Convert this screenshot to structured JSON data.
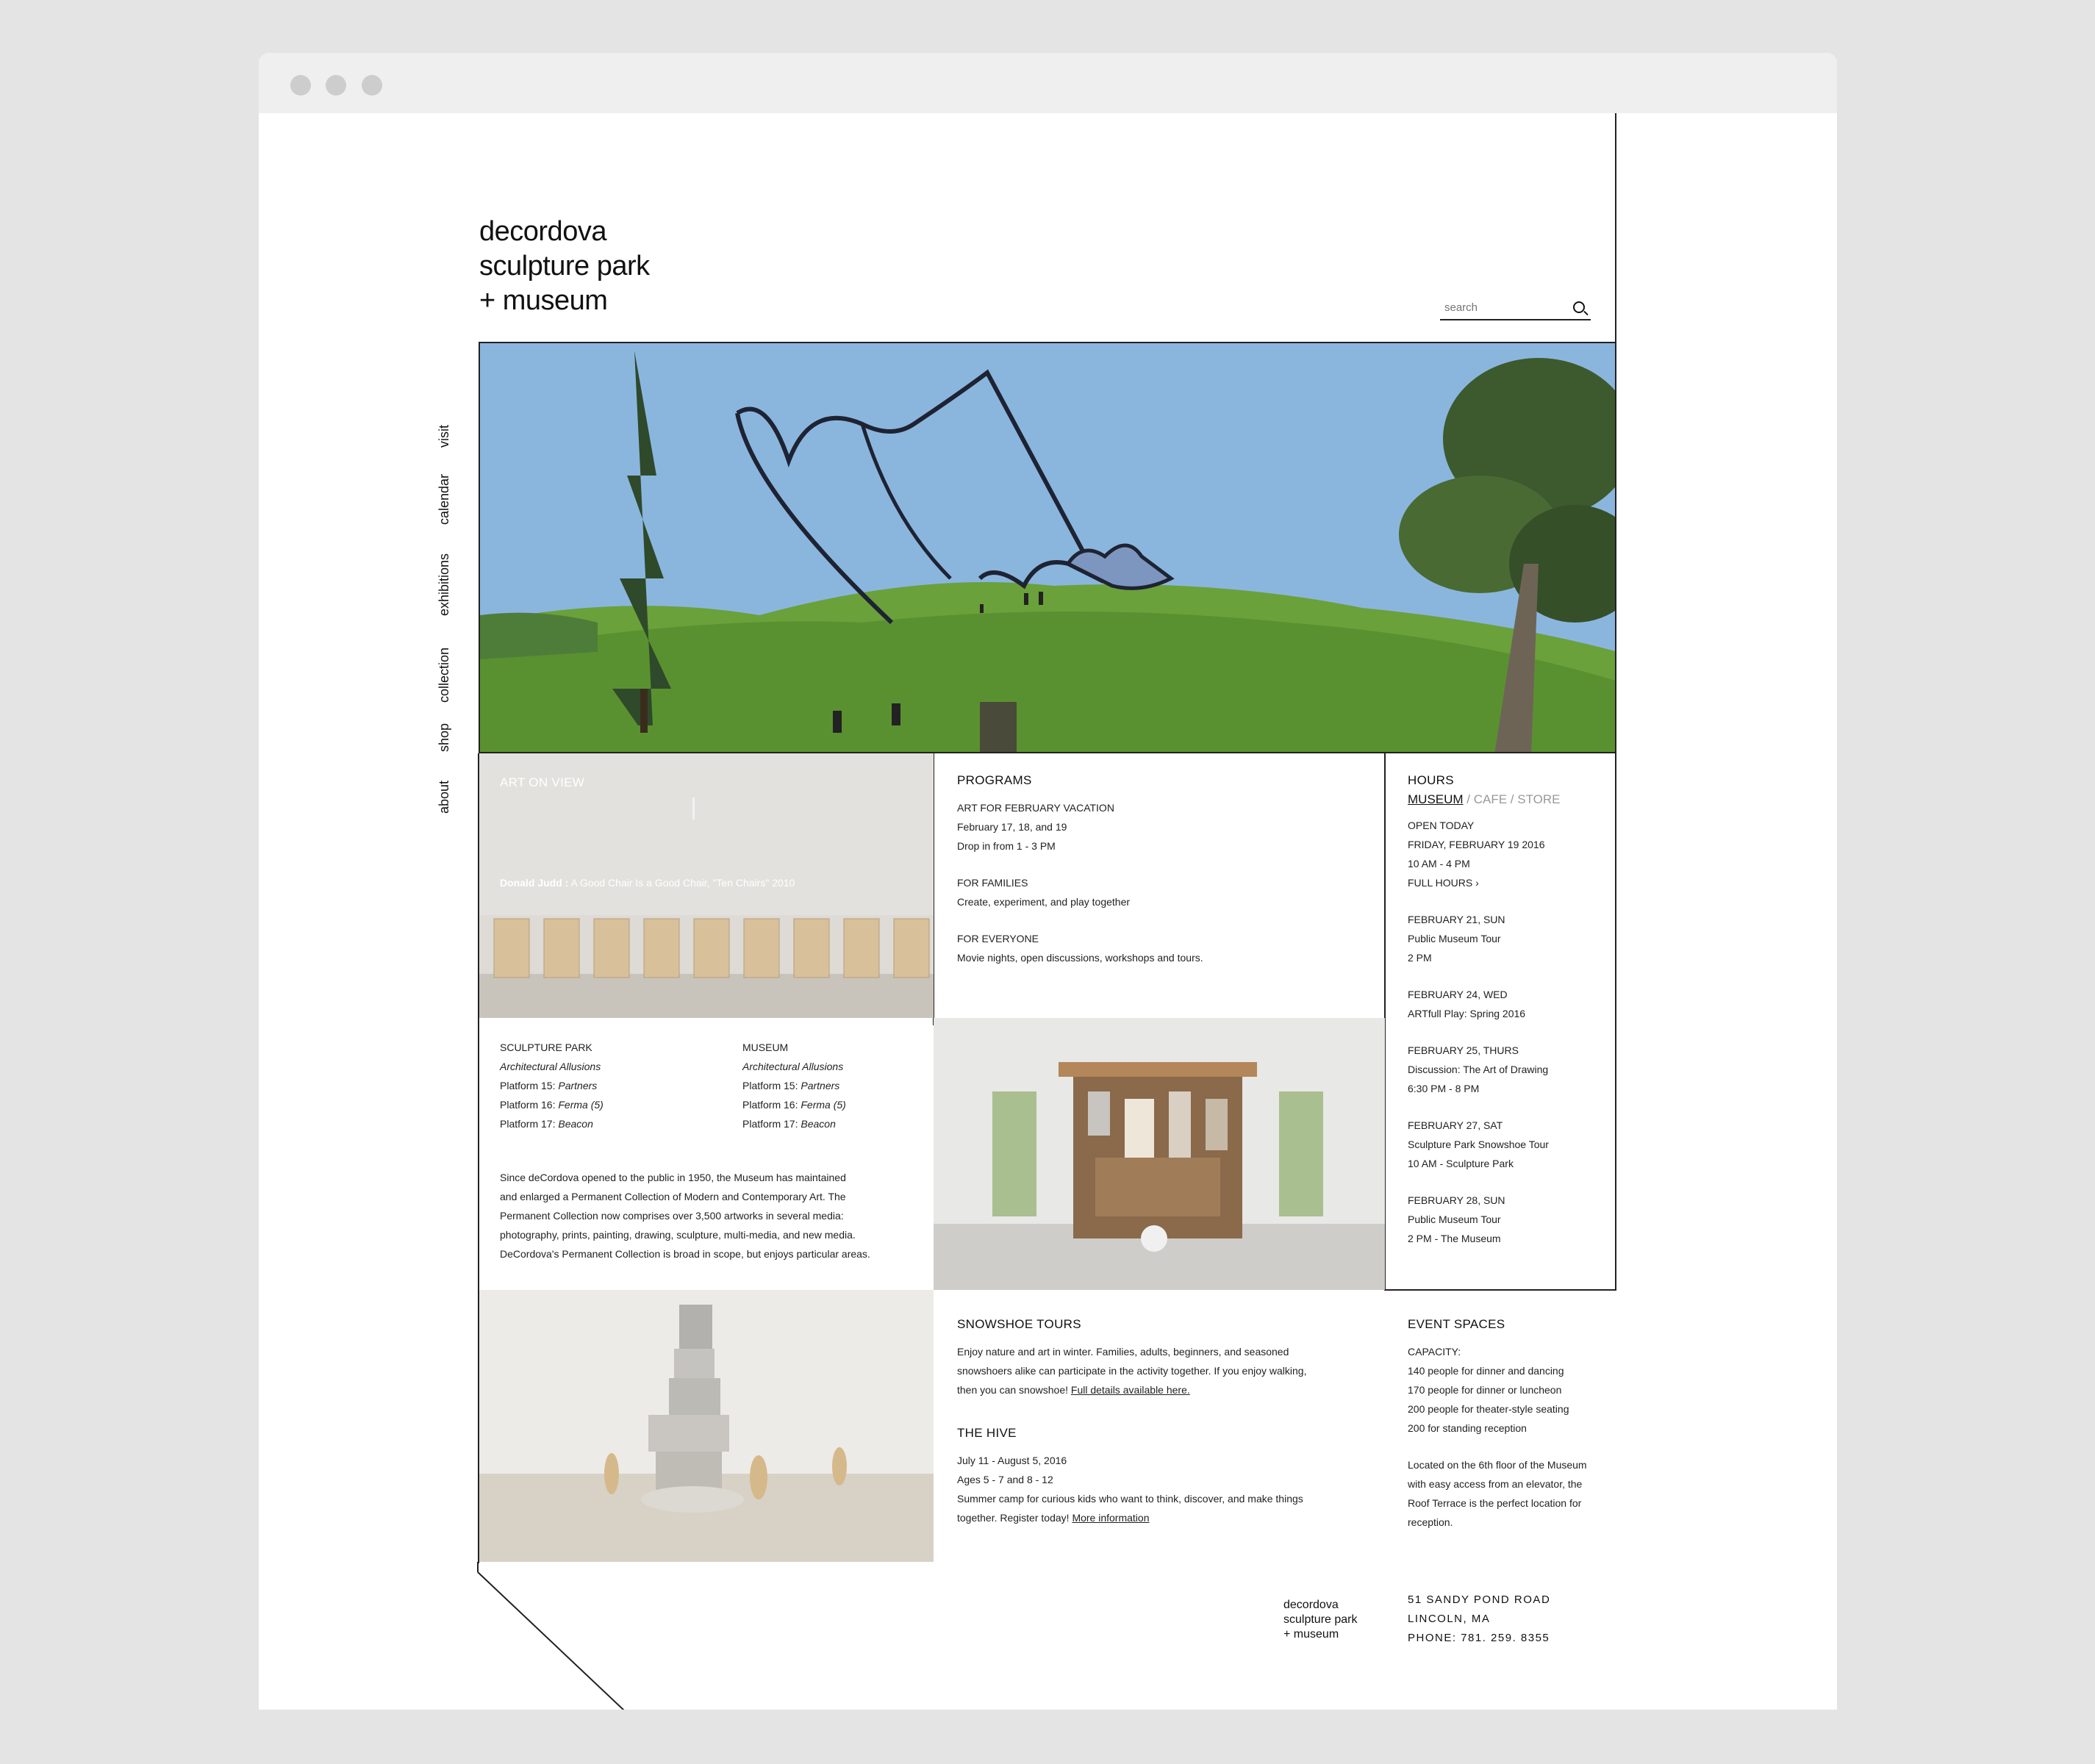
{
  "site": {
    "logo_lines": [
      "decordova",
      "sculpture park",
      "+ museum"
    ],
    "search_placeholder": "search"
  },
  "nav": {
    "items": [
      "visit",
      "calendar",
      "exhibitions",
      "collection",
      "shop",
      "about"
    ]
  },
  "art_on_view": {
    "title": "ART ON VIEW",
    "artist": "Donald Judd :",
    "work": "A Good Chair Is a Good Chair, \"Ten Chairs\" 2010"
  },
  "programs": {
    "title": "PROGRAMS",
    "items": [
      {
        "heading": "ART FOR FEBRUARY VACATION",
        "lines": [
          "February 17, 18, and 19",
          "Drop in from 1 - 3 PM"
        ]
      },
      {
        "heading": "FOR FAMILIES",
        "lines": [
          "Create, experiment, and play together"
        ]
      },
      {
        "heading": "FOR EVERYONE",
        "lines": [
          "Movie nights, open discussions, workshops and tours."
        ]
      }
    ]
  },
  "hours": {
    "title": "HOURS",
    "tabs": [
      "MUSEUM",
      "/ CAFE / STORE"
    ],
    "open_heading": "OPEN TODAY",
    "open_date": "FRIDAY, FEBRUARY 19 2016",
    "open_time": "10 AM - 4 PM",
    "full_hours": "FULL HOURS",
    "events": [
      {
        "date": "FEBRUARY 21, SUN",
        "lines": [
          "Public Museum Tour",
          "2 PM"
        ]
      },
      {
        "date": "FEBRUARY 24, WED",
        "lines": [
          "ARTfull Play: Spring 2016"
        ]
      },
      {
        "date": "FEBRUARY 25, THURS",
        "lines": [
          "Discussion: The Art of Drawing",
          "6:30 PM - 8 PM"
        ]
      },
      {
        "date": "FEBRUARY 27, SAT",
        "lines": [
          "Sculpture Park Snowshoe Tour",
          "10 AM - Sculpture Park"
        ]
      },
      {
        "date": "FEBRUARY 28, SUN",
        "lines": [
          "Public Museum Tour",
          "2 PM - The Museum"
        ]
      }
    ]
  },
  "collections": {
    "sculpture_park": {
      "title": "SCULPTURE PARK",
      "line1": "Architectural Allusions",
      "line2_a": "Platform 15:",
      "line2_b": "Partners",
      "line3_a": "Platform 16:",
      "line3_b": "Ferma (5)",
      "line4_a": "Platform 17:",
      "line4_b": "Beacon"
    },
    "museum": {
      "title": "MUSEUM",
      "line1": "Architectural Allusions",
      "line2_a": "Platform 15:",
      "line2_b": "Partners",
      "line3_a": "Platform 16:",
      "line3_b": "Ferma (5)",
      "line4_a": "Platform 17:",
      "line4_b": "Beacon"
    },
    "about_lines": [
      "Since deCordova opened to the public in 1950, the Museum has maintained",
      "and enlarged a Permanent Collection of Modern and Contemporary Art. The",
      "Permanent Collection now comprises over 3,500 artworks in several media:",
      "photography, prints, painting, drawing, sculpture, multi-media, and new media.",
      "DeCordova's Permanent Collection is broad in scope, but enjoys particular areas."
    ]
  },
  "snowshoe": {
    "title": "SNOWSHOE TOURS",
    "line1": "Enjoy nature and art in winter. Families, adults, beginners, and seasoned",
    "line2": "snowshoers alike can participate in the activity together. If you enjoy walking,",
    "line3": "then you can snowshoe!",
    "link": "Full details available here."
  },
  "hive": {
    "title": "THE HIVE",
    "line1": "July 11 - August 5, 2016",
    "line2": "Ages 5 - 7 and 8 - 12",
    "line3": "Summer camp for curious kids who want to think, discover, and make things",
    "line4": "together. Register today!",
    "link": "More information"
  },
  "event_spaces": {
    "title": "EVENT SPACES",
    "capacity_heading": "CAPACITY:",
    "capacity": [
      "140 people for dinner and dancing",
      "170 people for dinner or luncheon",
      "200 people for theater-style seating",
      "200 for standing reception"
    ],
    "desc": [
      "Located on the 6th floor of the Museum",
      "with easy access from an elevator, the",
      "Roof Terrace is the perfect location for",
      "reception."
    ]
  },
  "footer": {
    "logo_lines": [
      "decordova",
      "sculpture park",
      "+ museum"
    ],
    "address": [
      "51 SANDY POND ROAD",
      "LINCOLN, MA",
      "PHONE: 781. 259. 8355"
    ]
  }
}
